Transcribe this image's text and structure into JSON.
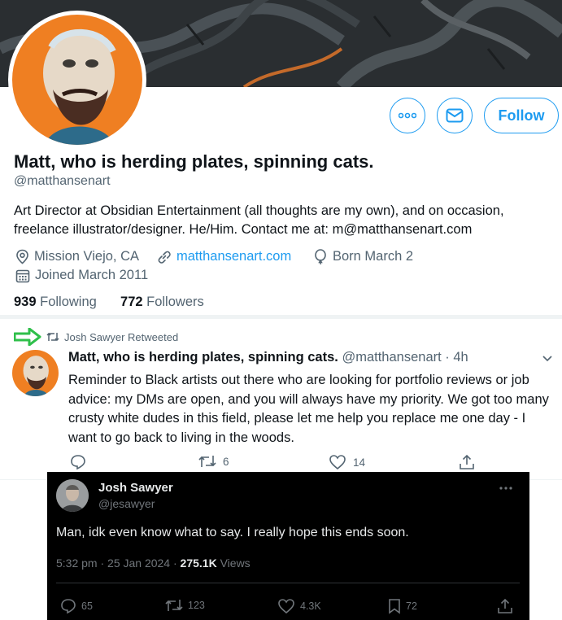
{
  "profile": {
    "display_name": "Matt, who is herding plates, spinning cats.",
    "handle": "@matthansenart",
    "bio": "Art Director at Obsidian Entertainment (all thoughts are my own), and on occasion, freelance illustrator/designer. He/Him. Contact me at: m@matthansenart.com",
    "location": "Mission Viejo, CA",
    "website": "matthansenart.com",
    "birthday": "Born March 2",
    "joined": "Joined March 2011",
    "following_count": "939",
    "following_label": "Following",
    "followers_count": "772",
    "followers_label": "Followers",
    "follow_label": "Follow",
    "more_icon": "more-icon",
    "message_icon": "mail-icon"
  },
  "retweet_tweet": {
    "retweeted_by": "Josh Sawyer Retweeted",
    "author_name": "Matt, who is herding plates, spinning cats.",
    "author_handle": "@matthansenart",
    "time": "· 4h",
    "text": "Reminder to Black artists out there who are looking for portfolio reviews or job advice: my DMs are open, and you will always have my priority. We got too many crusty white dudes in this field, please let me help you replace me one day - I want to go back to living in the woods.",
    "retweets": "6",
    "likes": "14"
  },
  "quoted_tweet": {
    "author_name": "Josh Sawyer",
    "author_handle": "@jesawyer",
    "text": "Man, idk even know what to say. I really hope this ends soon.",
    "timestamp": "5:32 pm · 25 Jan 2024 · ",
    "views_count": "275.1K",
    "views_label": " Views",
    "replies": "65",
    "retweets": "123",
    "likes": "4.3K",
    "bookmarks": "72"
  },
  "colors": {
    "accent": "#1d9bf0",
    "secondary_text": "#536471",
    "arrow": "#2fbf4a",
    "dark_bg": "#000000"
  }
}
